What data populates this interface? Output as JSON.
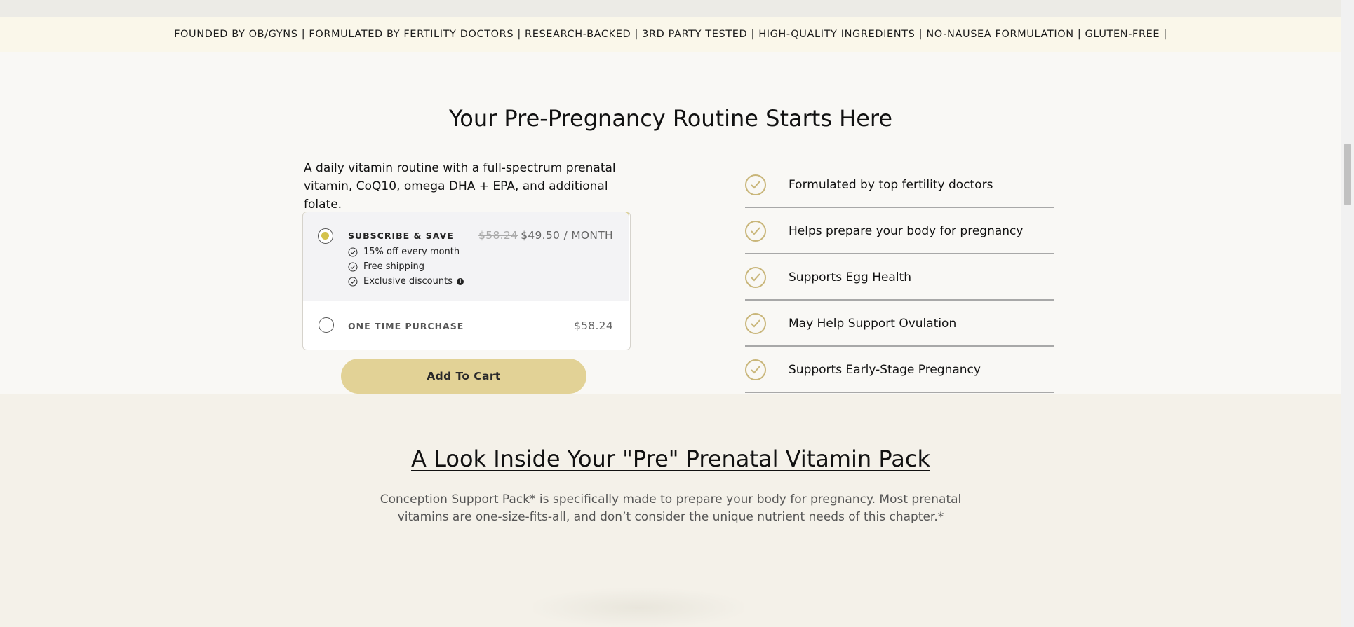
{
  "banner": {
    "text": "FOUNDED BY OB/GYNS | FORMULATED BY FERTILITY DOCTORS | RESEARCH-BACKED | 3RD PARTY TESTED | HIGH-QUALITY INGREDIENTS | NO-NAUSEA FORMULATION | GLUTEN-FREE |"
  },
  "routine": {
    "title": "Your Pre-Pregnancy Routine Starts Here",
    "description": "A daily vitamin routine with a full-spectrum prenatal vitamin, CoQ10, omega DHA + EPA, and additional folate.",
    "subscribe": {
      "label": "SUBSCRIBE & SAVE",
      "old_price": "$58.24",
      "price": "$49.50 / MONTH",
      "selected": true,
      "benefits": [
        "15% off every month",
        "Free shipping",
        "Exclusive discounts"
      ]
    },
    "one_time": {
      "label": "ONE TIME PURCHASE",
      "price": "$58.24",
      "selected": false
    },
    "cart_button": "Add To Cart",
    "features": [
      "Formulated by top fertility doctors",
      "Helps prepare your body for pregnancy",
      "Supports Egg Health",
      "May Help Support Ovulation",
      "Supports Early-Stage Pregnancy"
    ]
  },
  "pack": {
    "title": "A Look Inside Your \"Pre\" Prenatal Vitamin Pack",
    "description": "Conception Support Pack* is specifically made to prepare your body for pregnancy. Most prenatal vitamins are one-size-fits-all, and don’t consider the unique nutrient needs of this chapter.*"
  },
  "colors": {
    "accent": "#e2d296",
    "check": "#c9b67a",
    "radio_selected": "#d4c24c",
    "banner_bg": "#faf7ea"
  }
}
